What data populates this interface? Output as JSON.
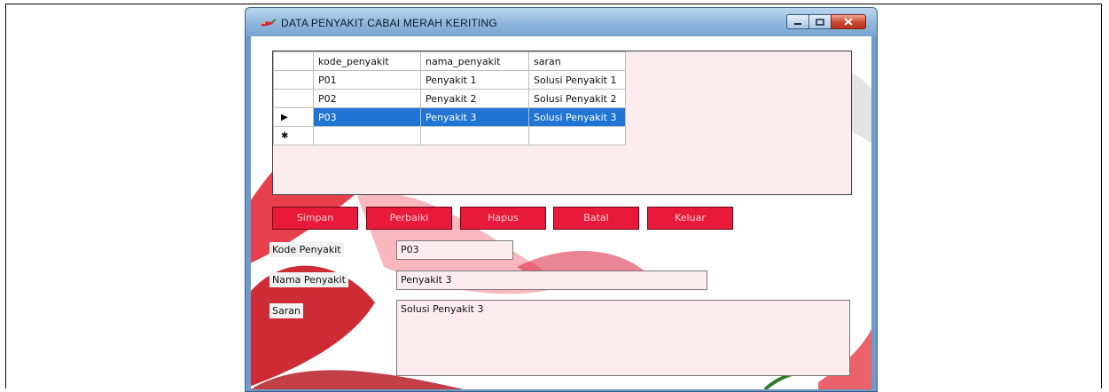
{
  "window": {
    "title": "DATA PENYAKIT CABAI MERAH KERITING"
  },
  "grid": {
    "columns": [
      "kode_penyakit",
      "nama_penyakit",
      "saran"
    ],
    "rows": [
      {
        "kode": "P01",
        "nama": "Penyakit 1",
        "saran": "Solusi Penyakit 1"
      },
      {
        "kode": "P02",
        "nama": "Penyakit 2",
        "saran": "Solusi Penyakit 2"
      },
      {
        "kode": "P03",
        "nama": "Penyakit 3",
        "saran": "Solusi Penyakit 3"
      }
    ],
    "selected_marker": "▶",
    "new_row_marker": "✱"
  },
  "buttons": {
    "simpan": "Simpan",
    "perbaiki": "Perbaiki",
    "hapus": "Hapus",
    "batal": "Batal",
    "keluar": "Keluar"
  },
  "form": {
    "kode_label": "Kode Penyakit",
    "kode_value": "P03",
    "nama_label": "Nama Penyakit",
    "nama_value": "Penyakit 3",
    "saran_label": "Saran",
    "saran_value": "Solusi Penyakit 3"
  },
  "colors": {
    "button_red": "#e8193a",
    "selection_blue": "#1f74d4",
    "field_pink": "#fdecef",
    "title_bar": "#8fb6dc"
  }
}
